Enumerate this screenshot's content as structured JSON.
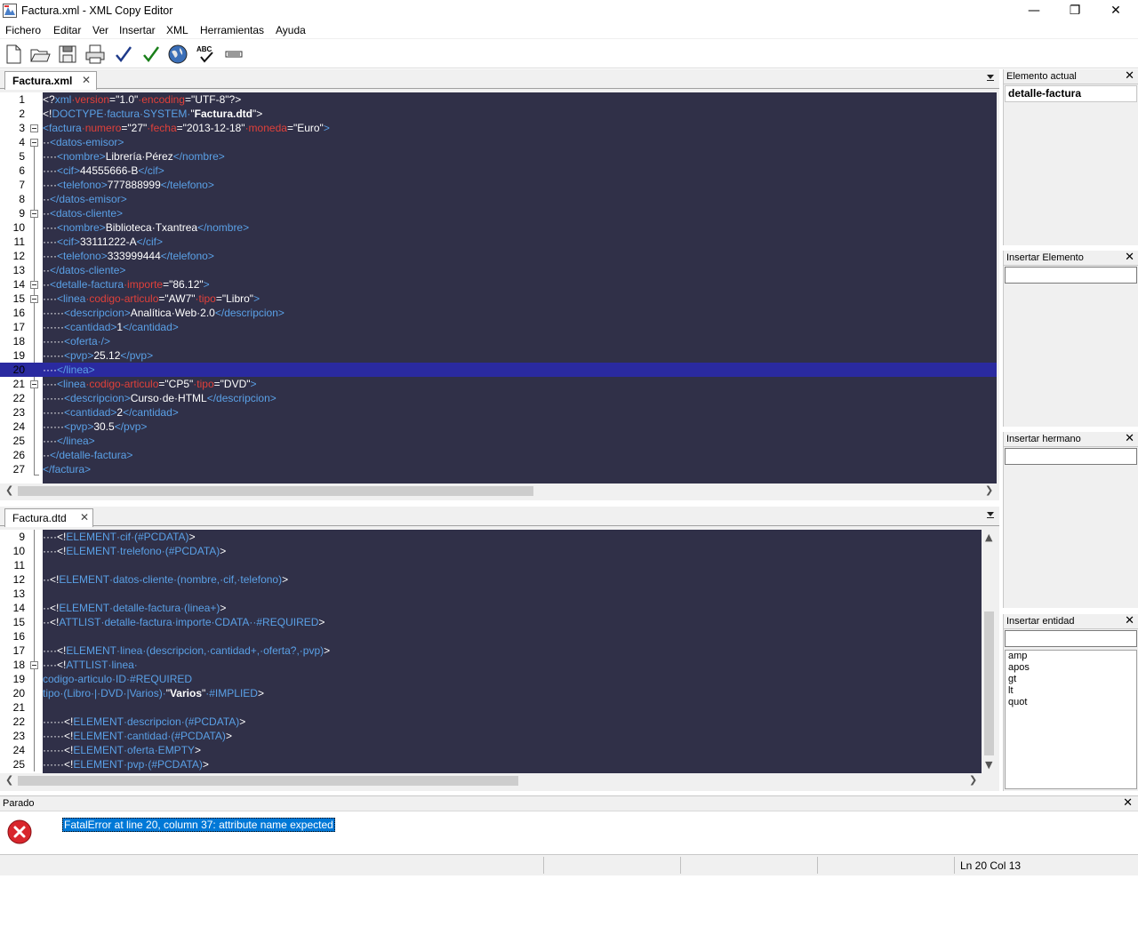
{
  "window": {
    "title": "Factura.xml - XML Copy Editor",
    "minimize": "—",
    "maximize": "❐",
    "close": "✕"
  },
  "menu": [
    {
      "label": "Fichero"
    },
    {
      "label": "Editar"
    },
    {
      "label": "Ver"
    },
    {
      "label": "Insertar"
    },
    {
      "label": "XML"
    },
    {
      "label": "Herramientas"
    },
    {
      "label": "Ayuda"
    }
  ],
  "toolbar": {
    "icons": [
      "new-document-icon",
      "open-folder-icon",
      "save-icon",
      "print-icon",
      "check-wellformed-icon",
      "validate-icon",
      "browser-globe-icon",
      "spellcheck-abc-icon",
      "xslt-transform-icon"
    ],
    "spell_label": "ABC"
  },
  "editor_top": {
    "tab_label": "Factura.xml",
    "tab_close": "✕",
    "highlight_line": 20,
    "lines": [
      {
        "n": "1",
        "tokens": [
          [
            "p",
            "<?"
          ],
          [
            "t",
            "xml"
          ],
          [
            "a",
            "·version"
          ],
          [
            "p",
            "="
          ],
          [
            "s",
            "\"1.0\""
          ],
          [
            "a",
            "·encoding"
          ],
          [
            "p",
            "="
          ],
          [
            "s",
            "\"UTF-8\""
          ],
          [
            "p",
            "?>"
          ]
        ]
      },
      {
        "n": "2",
        "tokens": [
          [
            "p",
            "<!"
          ],
          [
            "t",
            "DOCTYPE·factura·SYSTEM·"
          ],
          [
            "s",
            "\""
          ],
          [
            "b",
            "Factura.dtd"
          ],
          [
            "s",
            "\""
          ],
          [
            "p",
            ">"
          ]
        ]
      },
      {
        "n": "3",
        "tokens": [
          [
            "t",
            "<factura"
          ],
          [
            "a",
            "·numero"
          ],
          [
            "p",
            "="
          ],
          [
            "s",
            "\"27\""
          ],
          [
            "a",
            "·fecha"
          ],
          [
            "p",
            "="
          ],
          [
            "s",
            "\"2013-12-18\""
          ],
          [
            "a",
            "·moneda"
          ],
          [
            "p",
            "="
          ],
          [
            "s",
            "\"Euro\""
          ],
          [
            "t",
            ">"
          ]
        ]
      },
      {
        "n": "4",
        "tokens": [
          [
            "x",
            "··"
          ],
          [
            "t",
            "<datos-emisor>"
          ]
        ]
      },
      {
        "n": "5",
        "tokens": [
          [
            "x",
            "····"
          ],
          [
            "t",
            "<nombre>"
          ],
          [
            "x",
            "Librería·Pérez"
          ],
          [
            "t",
            "</nombre>"
          ]
        ]
      },
      {
        "n": "6",
        "tokens": [
          [
            "x",
            "····"
          ],
          [
            "t",
            "<cif>"
          ],
          [
            "x",
            "44555666-B"
          ],
          [
            "t",
            "</cif>"
          ]
        ]
      },
      {
        "n": "7",
        "tokens": [
          [
            "x",
            "····"
          ],
          [
            "t",
            "<telefono>"
          ],
          [
            "x",
            "777888999"
          ],
          [
            "t",
            "</telefono>"
          ]
        ]
      },
      {
        "n": "8",
        "tokens": [
          [
            "x",
            "··"
          ],
          [
            "t",
            "</datos-emisor>"
          ]
        ]
      },
      {
        "n": "9",
        "tokens": [
          [
            "x",
            "··"
          ],
          [
            "t",
            "<datos-cliente>"
          ]
        ]
      },
      {
        "n": "10",
        "tokens": [
          [
            "x",
            "····"
          ],
          [
            "t",
            "<nombre>"
          ],
          [
            "x",
            "Biblioteca·Txantrea"
          ],
          [
            "t",
            "</nombre>"
          ]
        ]
      },
      {
        "n": "11",
        "tokens": [
          [
            "x",
            "····"
          ],
          [
            "t",
            "<cif>"
          ],
          [
            "x",
            "33111222-A"
          ],
          [
            "t",
            "</cif>"
          ]
        ]
      },
      {
        "n": "12",
        "tokens": [
          [
            "x",
            "····"
          ],
          [
            "t",
            "<telefono>"
          ],
          [
            "x",
            "333999444"
          ],
          [
            "t",
            "</telefono>"
          ]
        ]
      },
      {
        "n": "13",
        "tokens": [
          [
            "x",
            "··"
          ],
          [
            "t",
            "</datos-cliente>"
          ]
        ]
      },
      {
        "n": "14",
        "tokens": [
          [
            "x",
            "··"
          ],
          [
            "t",
            "<detalle-factura"
          ],
          [
            "a",
            "·importe"
          ],
          [
            "p",
            "="
          ],
          [
            "s",
            "\"86.12\""
          ],
          [
            "t",
            ">"
          ]
        ]
      },
      {
        "n": "15",
        "tokens": [
          [
            "x",
            "····"
          ],
          [
            "t",
            "<linea"
          ],
          [
            "a",
            "·codigo-articulo"
          ],
          [
            "p",
            "="
          ],
          [
            "s",
            "\"AW7\""
          ],
          [
            "a",
            "·tipo"
          ],
          [
            "p",
            "="
          ],
          [
            "s",
            "\"Libro\""
          ],
          [
            "t",
            ">"
          ]
        ]
      },
      {
        "n": "16",
        "tokens": [
          [
            "x",
            "······"
          ],
          [
            "t",
            "<descripcion>"
          ],
          [
            "x",
            "Analítica·Web·2.0"
          ],
          [
            "t",
            "</descripcion>"
          ]
        ]
      },
      {
        "n": "17",
        "tokens": [
          [
            "x",
            "······"
          ],
          [
            "t",
            "<cantidad>"
          ],
          [
            "x",
            "1"
          ],
          [
            "t",
            "</cantidad>"
          ]
        ]
      },
      {
        "n": "18",
        "tokens": [
          [
            "x",
            "······"
          ],
          [
            "t",
            "<oferta·/>"
          ]
        ]
      },
      {
        "n": "19",
        "tokens": [
          [
            "x",
            "······"
          ],
          [
            "t",
            "<pvp>"
          ],
          [
            "x",
            "25.12"
          ],
          [
            "t",
            "</pvp>"
          ]
        ]
      },
      {
        "n": "20",
        "tokens": [
          [
            "x",
            "····"
          ],
          [
            "t",
            "</linea>"
          ]
        ]
      },
      {
        "n": "21",
        "tokens": [
          [
            "x",
            "····"
          ],
          [
            "t",
            "<linea"
          ],
          [
            "a",
            "·codigo-articulo"
          ],
          [
            "p",
            "="
          ],
          [
            "s",
            "\"CP5\""
          ],
          [
            "a",
            "·tipo"
          ],
          [
            "p",
            "="
          ],
          [
            "s",
            "\"DVD\""
          ],
          [
            "t",
            ">"
          ]
        ]
      },
      {
        "n": "22",
        "tokens": [
          [
            "x",
            "······"
          ],
          [
            "t",
            "<descripcion>"
          ],
          [
            "x",
            "Curso·de·HTML"
          ],
          [
            "t",
            "</descripcion>"
          ]
        ]
      },
      {
        "n": "23",
        "tokens": [
          [
            "x",
            "······"
          ],
          [
            "t",
            "<cantidad>"
          ],
          [
            "x",
            "2"
          ],
          [
            "t",
            "</cantidad>"
          ]
        ]
      },
      {
        "n": "24",
        "tokens": [
          [
            "x",
            "······"
          ],
          [
            "t",
            "<pvp>"
          ],
          [
            "x",
            "30.5"
          ],
          [
            "t",
            "</pvp>"
          ]
        ]
      },
      {
        "n": "25",
        "tokens": [
          [
            "x",
            "····"
          ],
          [
            "t",
            "</linea>"
          ]
        ]
      },
      {
        "n": "26",
        "tokens": [
          [
            "x",
            "··"
          ],
          [
            "t",
            "</detalle-factura>"
          ]
        ]
      },
      {
        "n": "27",
        "tokens": [
          [
            "t",
            "</factura>"
          ]
        ]
      }
    ]
  },
  "editor_bottom": {
    "tab_label": "Factura.dtd",
    "tab_close": "✕",
    "lines": [
      {
        "n": "9",
        "tokens": [
          [
            "x",
            "····"
          ],
          [
            "p",
            "<!"
          ],
          [
            "t",
            "ELEMENT·cif·(#PCDATA)"
          ],
          [
            "p",
            ">"
          ]
        ]
      },
      {
        "n": "10",
        "tokens": [
          [
            "x",
            "····"
          ],
          [
            "p",
            "<!"
          ],
          [
            "t",
            "ELEMENT·trelefono·(#PCDATA)"
          ],
          [
            "p",
            ">"
          ]
        ]
      },
      {
        "n": "11",
        "tokens": []
      },
      {
        "n": "12",
        "tokens": [
          [
            "x",
            "··"
          ],
          [
            "p",
            "<!"
          ],
          [
            "t",
            "ELEMENT·datos-cliente·(nombre,·cif,·telefono)"
          ],
          [
            "p",
            ">"
          ]
        ]
      },
      {
        "n": "13",
        "tokens": []
      },
      {
        "n": "14",
        "tokens": [
          [
            "x",
            "··"
          ],
          [
            "p",
            "<!"
          ],
          [
            "t",
            "ELEMENT·detalle-factura·(linea+)"
          ],
          [
            "p",
            ">"
          ]
        ]
      },
      {
        "n": "15",
        "tokens": [
          [
            "x",
            "··"
          ],
          [
            "p",
            "<!"
          ],
          [
            "t",
            "ATTLIST·detalle-factura·importe·CDATA··#REQUIRED"
          ],
          [
            "p",
            ">"
          ]
        ]
      },
      {
        "n": "16",
        "tokens": []
      },
      {
        "n": "17",
        "tokens": [
          [
            "x",
            "····"
          ],
          [
            "p",
            "<!"
          ],
          [
            "t",
            "ELEMENT·linea·(descripcion,·cantidad+,·oferta?,·pvp)"
          ],
          [
            "p",
            ">"
          ]
        ]
      },
      {
        "n": "18",
        "tokens": [
          [
            "x",
            "····"
          ],
          [
            "p",
            "<!"
          ],
          [
            "t",
            "ATTLIST·linea·"
          ]
        ]
      },
      {
        "n": "19",
        "tokens": [
          [
            "t",
            "codigo-articulo·ID·#REQUIRED"
          ]
        ]
      },
      {
        "n": "20",
        "tokens": [
          [
            "t",
            "tipo·(Libro·|·DVD·|Varios)·"
          ],
          [
            "s",
            "\""
          ],
          [
            "b",
            "Varios"
          ],
          [
            "s",
            "\""
          ],
          [
            "t",
            "·#IMPLIED"
          ],
          [
            "p",
            ">"
          ]
        ]
      },
      {
        "n": "21",
        "tokens": []
      },
      {
        "n": "22",
        "tokens": [
          [
            "x",
            "······"
          ],
          [
            "p",
            "<!"
          ],
          [
            "t",
            "ELEMENT·descripcion·(#PCDATA)"
          ],
          [
            "p",
            ">"
          ]
        ]
      },
      {
        "n": "23",
        "tokens": [
          [
            "x",
            "······"
          ],
          [
            "p",
            "<!"
          ],
          [
            "t",
            "ELEMENT·cantidad·(#PCDATA)"
          ],
          [
            "p",
            ">"
          ]
        ]
      },
      {
        "n": "24",
        "tokens": [
          [
            "x",
            "······"
          ],
          [
            "p",
            "<!"
          ],
          [
            "t",
            "ELEMENT·oferta·EMPTY"
          ],
          [
            "p",
            ">"
          ]
        ]
      },
      {
        "n": "25",
        "tokens": [
          [
            "x",
            "······"
          ],
          [
            "p",
            "<!"
          ],
          [
            "t",
            "ELEMENT·pvp·(#PCDATA)"
          ],
          [
            "p",
            ">"
          ]
        ]
      }
    ]
  },
  "side": {
    "elemento_actual": {
      "title": "Elemento actual",
      "value": "detalle-factura"
    },
    "insertar_elemento": {
      "title": "Insertar Elemento",
      "value": ""
    },
    "insertar_hermano": {
      "title": "Insertar hermano",
      "value": ""
    },
    "insertar_entidad": {
      "title": "Insertar entidad",
      "value": "",
      "items": [
        "amp",
        "apos",
        "gt",
        "lt",
        "quot"
      ]
    },
    "close": "✕"
  },
  "output": {
    "title": "Parado",
    "close": "✕",
    "message": "FatalError at line 20, column 37: attribute name expected"
  },
  "statusbar": {
    "position": "Ln 20 Col 13"
  },
  "colors": {
    "editor_bg": "#303048",
    "tag": "#5aa0e6",
    "attribute": "#e0403a",
    "highlight": "#2a2aa0",
    "error_red": "#d8262c",
    "selection": "#0078d7"
  }
}
